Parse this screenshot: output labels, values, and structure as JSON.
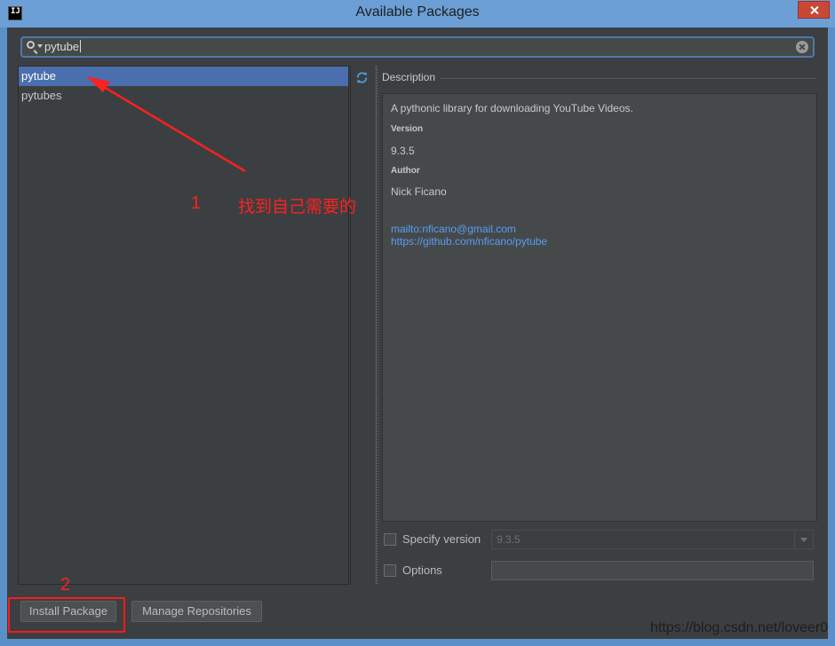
{
  "window": {
    "title": "Available Packages",
    "app_icon_text": "IJ"
  },
  "search": {
    "query": "pytube"
  },
  "packages": [
    {
      "name": "pytube",
      "selected": true
    },
    {
      "name": "pytubes",
      "selected": false
    }
  ],
  "description": {
    "header": "Description",
    "summary": "A pythonic library for downloading YouTube Videos.",
    "version_label": "Version",
    "version_value": "9.3.5",
    "author_label": "Author",
    "author_value": "Nick Ficano",
    "links": [
      "mailto:nficano@gmail.com",
      "https://github.com/nficano/pytube"
    ]
  },
  "options": {
    "specify_version_label": "Specify version",
    "version_selected": "9.3.5",
    "options_label": "Options",
    "options_value": ""
  },
  "buttons": {
    "install": "Install Package",
    "manage": "Manage Repositories"
  },
  "annotations": {
    "step1_number": "1",
    "step1_text": "找到自己需要的",
    "step2_number": "2",
    "color": "#ff2020"
  },
  "watermark": "https://blog.csdn.net/loveer0",
  "colors": {
    "selection": "#4b6eaf",
    "link": "#589df6",
    "background": "#3c3f41"
  }
}
